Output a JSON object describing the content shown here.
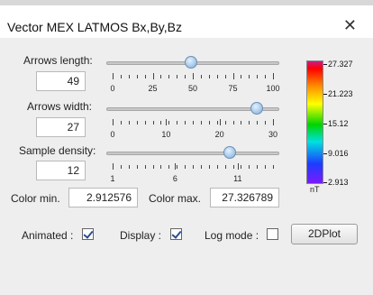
{
  "window": {
    "title": "Vector MEX LATMOS  Bx,By,Bz"
  },
  "sliders": [
    {
      "label": "Arrows length:",
      "value": "49",
      "level": 0.49,
      "ticks": [
        "0",
        "25",
        "50",
        "75",
        "100"
      ]
    },
    {
      "label": "Arrows width:",
      "value": "27",
      "level": 0.9,
      "ticks": [
        "0",
        "10",
        "20",
        "30"
      ]
    },
    {
      "label": "Sample density:",
      "value": "12",
      "level": 0.733,
      "ticks": [
        "1",
        "6",
        "11"
      ]
    }
  ],
  "color_range": {
    "min_label": "Color min.",
    "min_value": "2.912576",
    "max_label": "Color max.",
    "max_value": "27.326789"
  },
  "options": {
    "animated_label": "Animated :",
    "animated": true,
    "display_label": "Display :",
    "display": true,
    "logmode_label": "Log mode :",
    "logmode": false,
    "plot_button": "2DPlot"
  },
  "colorbar": {
    "labels": [
      "27.327",
      "21.223",
      "15.12",
      "9.016",
      "2.913"
    ],
    "unit": "nT"
  }
}
